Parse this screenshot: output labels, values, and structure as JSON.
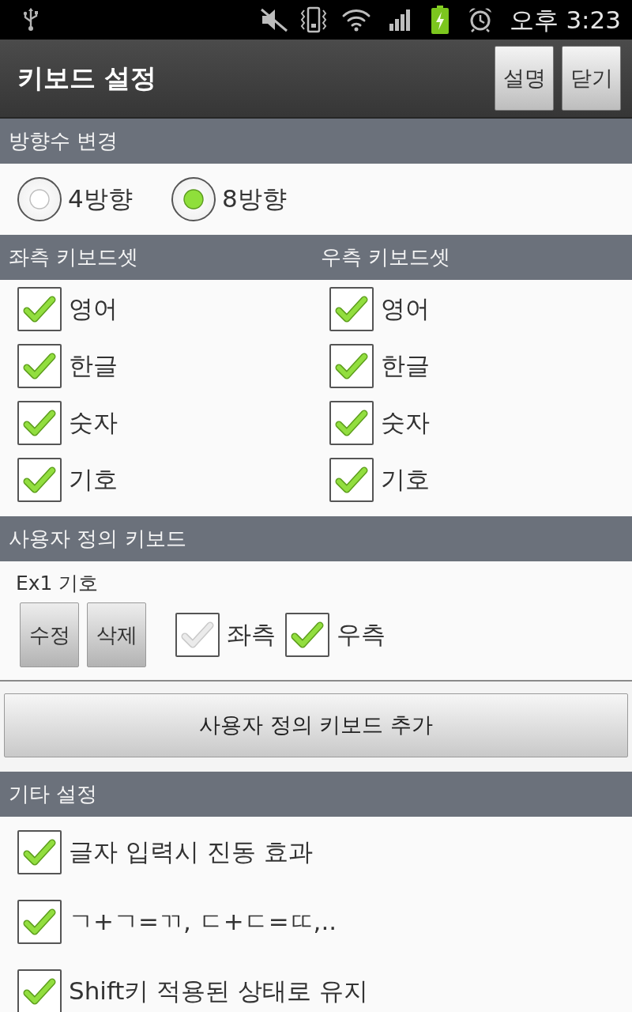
{
  "status_bar": {
    "time": "오후 3:23"
  },
  "title_bar": {
    "title": "키보드 설정",
    "buttons": [
      "설명",
      "닫기"
    ]
  },
  "direction": {
    "header": "방향수 변경",
    "options": [
      {
        "label": "4방향",
        "selected": false
      },
      {
        "label": "8방향",
        "selected": true
      }
    ]
  },
  "keyboard_sets": {
    "columns": [
      {
        "header": "좌측 키보드셋",
        "items": [
          {
            "label": "영어",
            "checked": true
          },
          {
            "label": "한글",
            "checked": true
          },
          {
            "label": "숫자",
            "checked": true
          },
          {
            "label": "기호",
            "checked": true
          }
        ]
      },
      {
        "header": "우측 키보드셋",
        "items": [
          {
            "label": "영어",
            "checked": true
          },
          {
            "label": "한글",
            "checked": true
          },
          {
            "label": "숫자",
            "checked": true
          },
          {
            "label": "기호",
            "checked": true
          }
        ]
      }
    ]
  },
  "custom_keyboards": {
    "header": "사용자 정의 키보드",
    "items": [
      {
        "name": "Ex1 기호",
        "buttons": [
          "수정",
          "삭제"
        ],
        "sides": [
          {
            "label": "좌측",
            "checked": false
          },
          {
            "label": "우측",
            "checked": true
          }
        ]
      }
    ],
    "add_button": "사용자 정의 키보드 추가"
  },
  "other_settings": {
    "header": "기타 설정",
    "items": [
      {
        "label": "글자 입력시 진동 효과",
        "checked": true
      },
      {
        "label": "ㄱ+ㄱ=ㄲ, ㄷ+ㄷ=ㄸ,..",
        "checked": true
      },
      {
        "label": "Shift키 적용된 상태로 유지",
        "checked": true
      }
    ]
  }
}
